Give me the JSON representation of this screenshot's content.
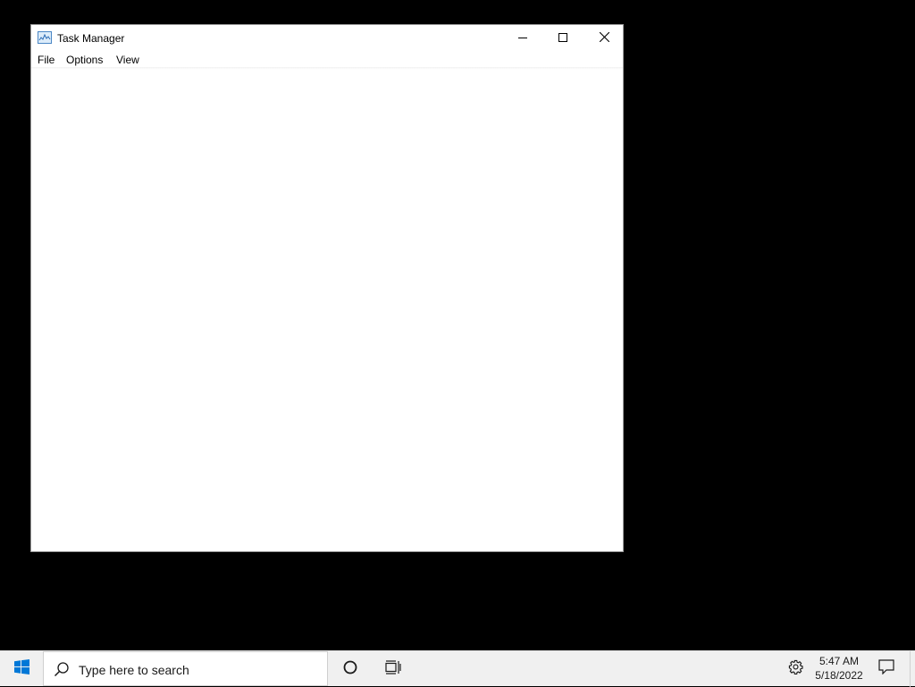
{
  "window": {
    "title": "Task Manager",
    "icon": "task-manager-icon",
    "controls": {
      "minimize": "minimize-icon",
      "maximize": "maximize-icon",
      "close": "close-icon"
    }
  },
  "menu": {
    "file": "File",
    "options": "Options",
    "view": "View"
  },
  "taskbar": {
    "start_icon": "windows-logo-icon",
    "search_placeholder": "Type here to search",
    "cortana_icon": "cortana-circle-icon",
    "taskview_icon": "task-view-icon",
    "settings_icon": "gear-icon",
    "time": "5:47 AM",
    "date": "5/18/2022",
    "notification_icon": "action-center-icon"
  },
  "colors": {
    "desktop": "#000000",
    "window_bg": "#ffffff",
    "taskbar_bg": "#f0f0f0",
    "windows_logo": "#0078d7"
  }
}
